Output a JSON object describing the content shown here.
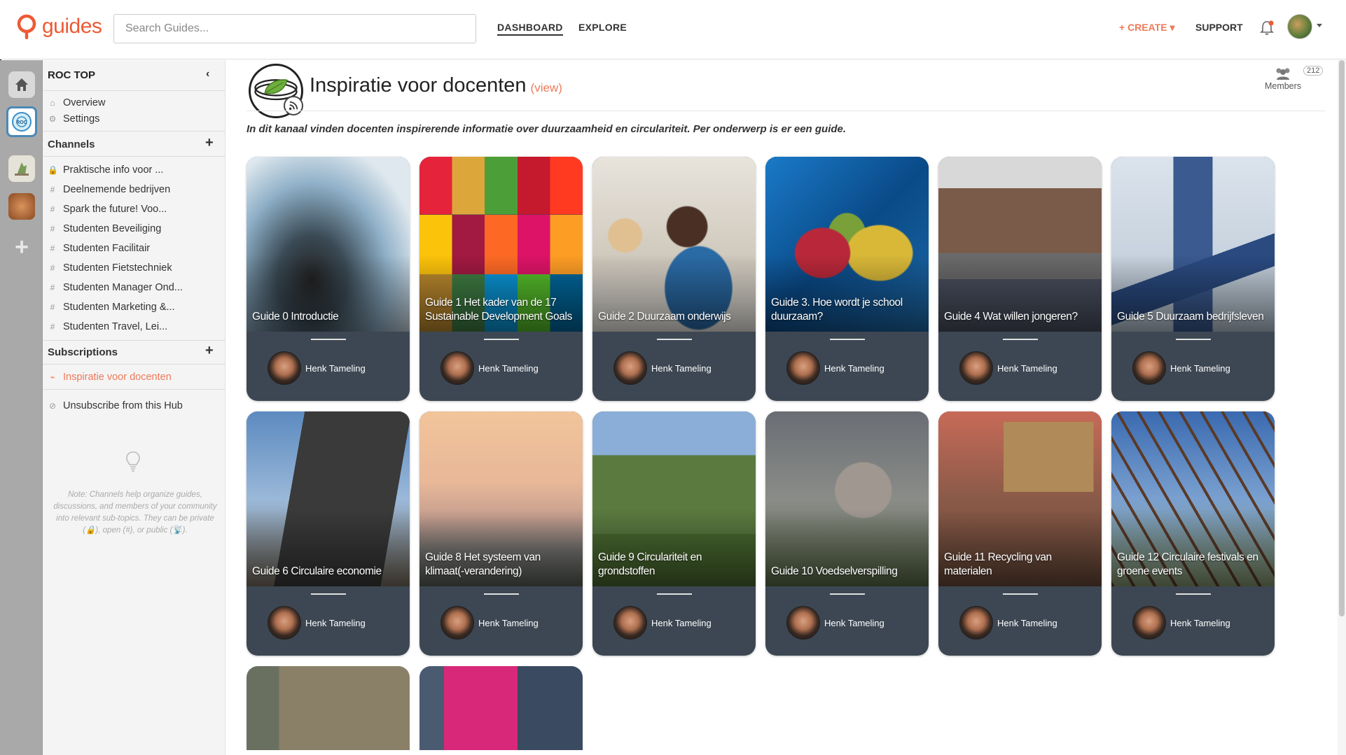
{
  "app": {
    "logo_text": "guides"
  },
  "search": {
    "placeholder": "Search Guides..."
  },
  "nav": {
    "dashboard": "DASHBOARD",
    "explore": "EXPLORE",
    "create": "+ CREATE ▾",
    "support": "SUPPORT"
  },
  "sidebar": {
    "hub_title": "ROC TOP",
    "overview": "Overview",
    "settings": "Settings",
    "channels_heading": "Channels",
    "channels": [
      {
        "label": "Praktische info voor ...",
        "icon": "lock-icon"
      },
      {
        "label": "Deelnemende bedrijven",
        "icon": "hash-icon"
      },
      {
        "label": "Spark the future! Voo...",
        "icon": "hash-icon"
      },
      {
        "label": "Studenten Beveiliging",
        "icon": "hash-icon"
      },
      {
        "label": "Studenten Facilitair",
        "icon": "hash-icon"
      },
      {
        "label": "Studenten Fietstechniek",
        "icon": "hash-icon"
      },
      {
        "label": "Studenten Manager Ond...",
        "icon": "hash-icon"
      },
      {
        "label": "Studenten Marketing &...",
        "icon": "hash-icon"
      },
      {
        "label": "Studenten Travel, Lei...",
        "icon": "hash-icon"
      }
    ],
    "subscriptions_heading": "Subscriptions",
    "subscriptions": [
      {
        "label": "Inspiratie voor docenten",
        "icon": "rss-icon"
      }
    ],
    "unsubscribe": "Unsubscribe from this Hub",
    "note": "Note: Channels help organize guides, discussions, and members of your community into relevant sub-topics. They can be private (🔒), open (#), or public (📡)."
  },
  "channel": {
    "title": "Inspiratie voor docenten",
    "view_link": "(view)",
    "members_label": "Members",
    "members_count": "212",
    "description": "In dit kanaal vinden docenten inspirerende informatie over duurzaamheid en circulariteit. Per onderwerp is er een guide."
  },
  "guides": [
    {
      "title": "Guide 0 Introductie",
      "author": "Henk Tameling"
    },
    {
      "title": "Guide 1 Het kader van de 17 Sustainable Development Goals",
      "author": "Henk Tameling"
    },
    {
      "title": "Guide 2 Duurzaam onderwijs",
      "author": "Henk Tameling"
    },
    {
      "title": "Guide 3. Hoe wordt je school duurzaam?",
      "author": "Henk Tameling"
    },
    {
      "title": "Guide 4 Wat willen jongeren?",
      "author": "Henk Tameling"
    },
    {
      "title": "Guide 5 Duurzaam bedrijfsleven",
      "author": "Henk Tameling"
    },
    {
      "title": "Guide 6 Circulaire economie",
      "author": "Henk Tameling"
    },
    {
      "title": "Guide 8 Het systeem van klimaat(-verandering)",
      "author": "Henk Tameling"
    },
    {
      "title": "Guide 9 Circulariteit en grondstoffen",
      "author": "Henk Tameling"
    },
    {
      "title": "Guide 10 Voedselverspilling",
      "author": "Henk Tameling"
    },
    {
      "title": "Guide 11 Recycling van materialen",
      "author": "Henk Tameling"
    },
    {
      "title": "Guide 12 Circulaire festivals en groene events",
      "author": "Henk Tameling"
    }
  ],
  "colors": {
    "accent": "#ee7a5a",
    "card_footer": "#3d4753",
    "rail": "#a9a9a9"
  }
}
